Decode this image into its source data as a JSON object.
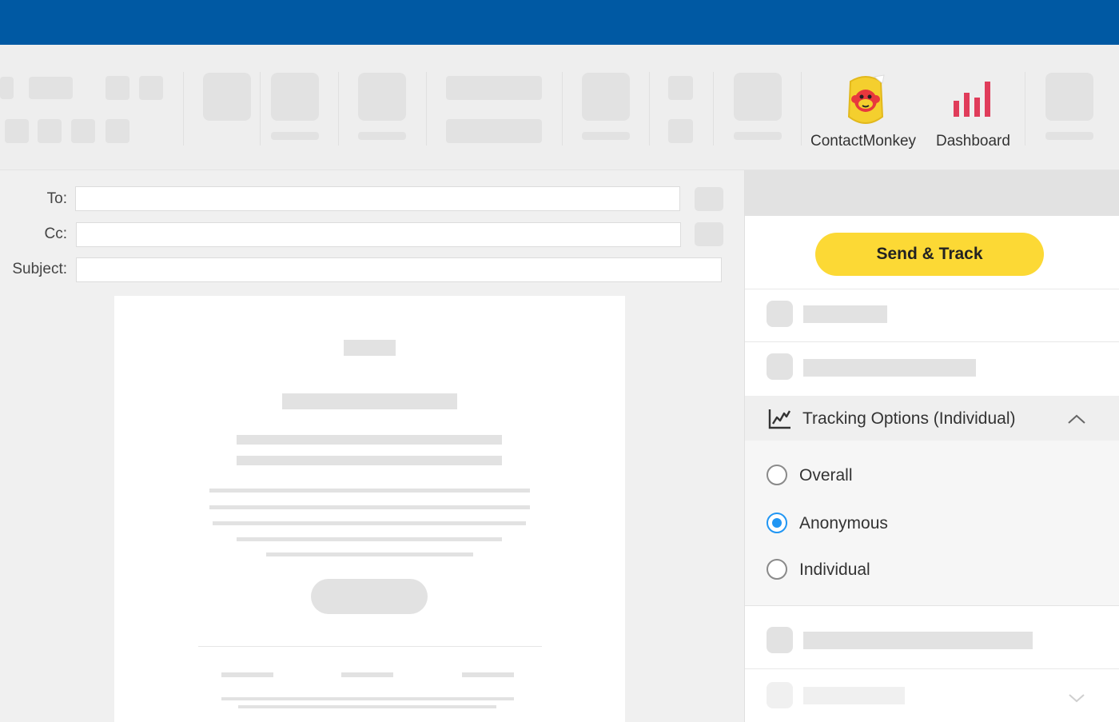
{
  "ribbon": {
    "contactmonkey_label": "ContactMonkey",
    "dashboard_label": "Dashboard"
  },
  "compose": {
    "to_label": "To:",
    "cc_label": "Cc:",
    "subject_label": "Subject:",
    "to_value": "",
    "cc_value": "",
    "subject_value": ""
  },
  "panel": {
    "send_track_label": "Send & Track",
    "tracking_title": "Tracking Options (Individual)",
    "options": [
      {
        "label": "Overall",
        "selected": false
      },
      {
        "label": "Anonymous",
        "selected": true
      },
      {
        "label": "Individual",
        "selected": false
      }
    ]
  },
  "colors": {
    "topbar": "#0059a3",
    "send_button": "#fcd935",
    "radio_selected": "#2196f3",
    "dashboard_bars": "#e03c5a"
  },
  "icons": {
    "monkey": "contactmonkey-logo-icon",
    "dashboard": "bar-chart-icon",
    "tracking": "line-chart-icon",
    "collapse": "chevron-up-icon",
    "expand": "chevron-down-icon"
  }
}
